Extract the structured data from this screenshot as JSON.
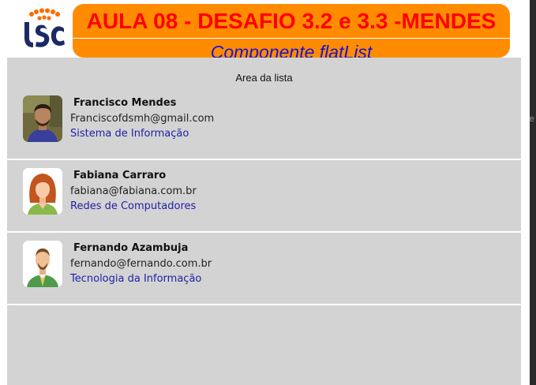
{
  "header": {
    "logo_text": "USC",
    "title": "AULA 08 - DESAFIO 3.2 e 3.3 -MENDES",
    "subtitle": "Componente flatList",
    "colors": {
      "banner": "#ff8c00",
      "title": "#ff0000",
      "subtitle": "#1a12d6"
    }
  },
  "list": {
    "header": "Area da lista",
    "items": [
      {
        "name": "Francisco Mendes",
        "email": "Franciscofdsmh@gmail.com",
        "course": "Sistema de Informação",
        "avatar": "person-photo-icon"
      },
      {
        "name": "Fabiana Carraro",
        "email": "fabiana@fabiana.com.br",
        "course": "Redes de Computadores",
        "avatar": "woman-avatar-icon"
      },
      {
        "name": "Fernando Azambuja",
        "email": "fernando@fernando.com.br",
        "course": "Tecnologia da Informação",
        "avatar": "man-avatar-icon"
      }
    ]
  },
  "edge_mark": "e"
}
